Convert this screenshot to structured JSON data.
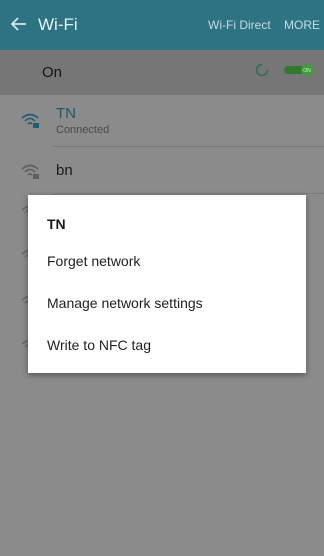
{
  "appbar": {
    "title": "Wi-Fi",
    "wifi_direct_label": "Wi-Fi Direct",
    "more_label": "MORE"
  },
  "wifi_switch": {
    "label": "On",
    "toggle_text": "ON"
  },
  "networks": [
    {
      "ssid": "TN",
      "status": "Connected"
    },
    {
      "ssid": "bn",
      "status": ""
    }
  ],
  "dialog": {
    "title": "TN",
    "items": [
      "Forget network",
      "Manage network settings",
      "Write to NFC tag"
    ]
  },
  "colors": {
    "appbar": "#2d7382",
    "accent": "#1c5a6b",
    "toggle_green": "#3e9b3e"
  },
  "icons": [
    "back-arrow-icon",
    "refresh-spinner-icon",
    "toggle-switch",
    "wifi-secure-icon"
  ]
}
